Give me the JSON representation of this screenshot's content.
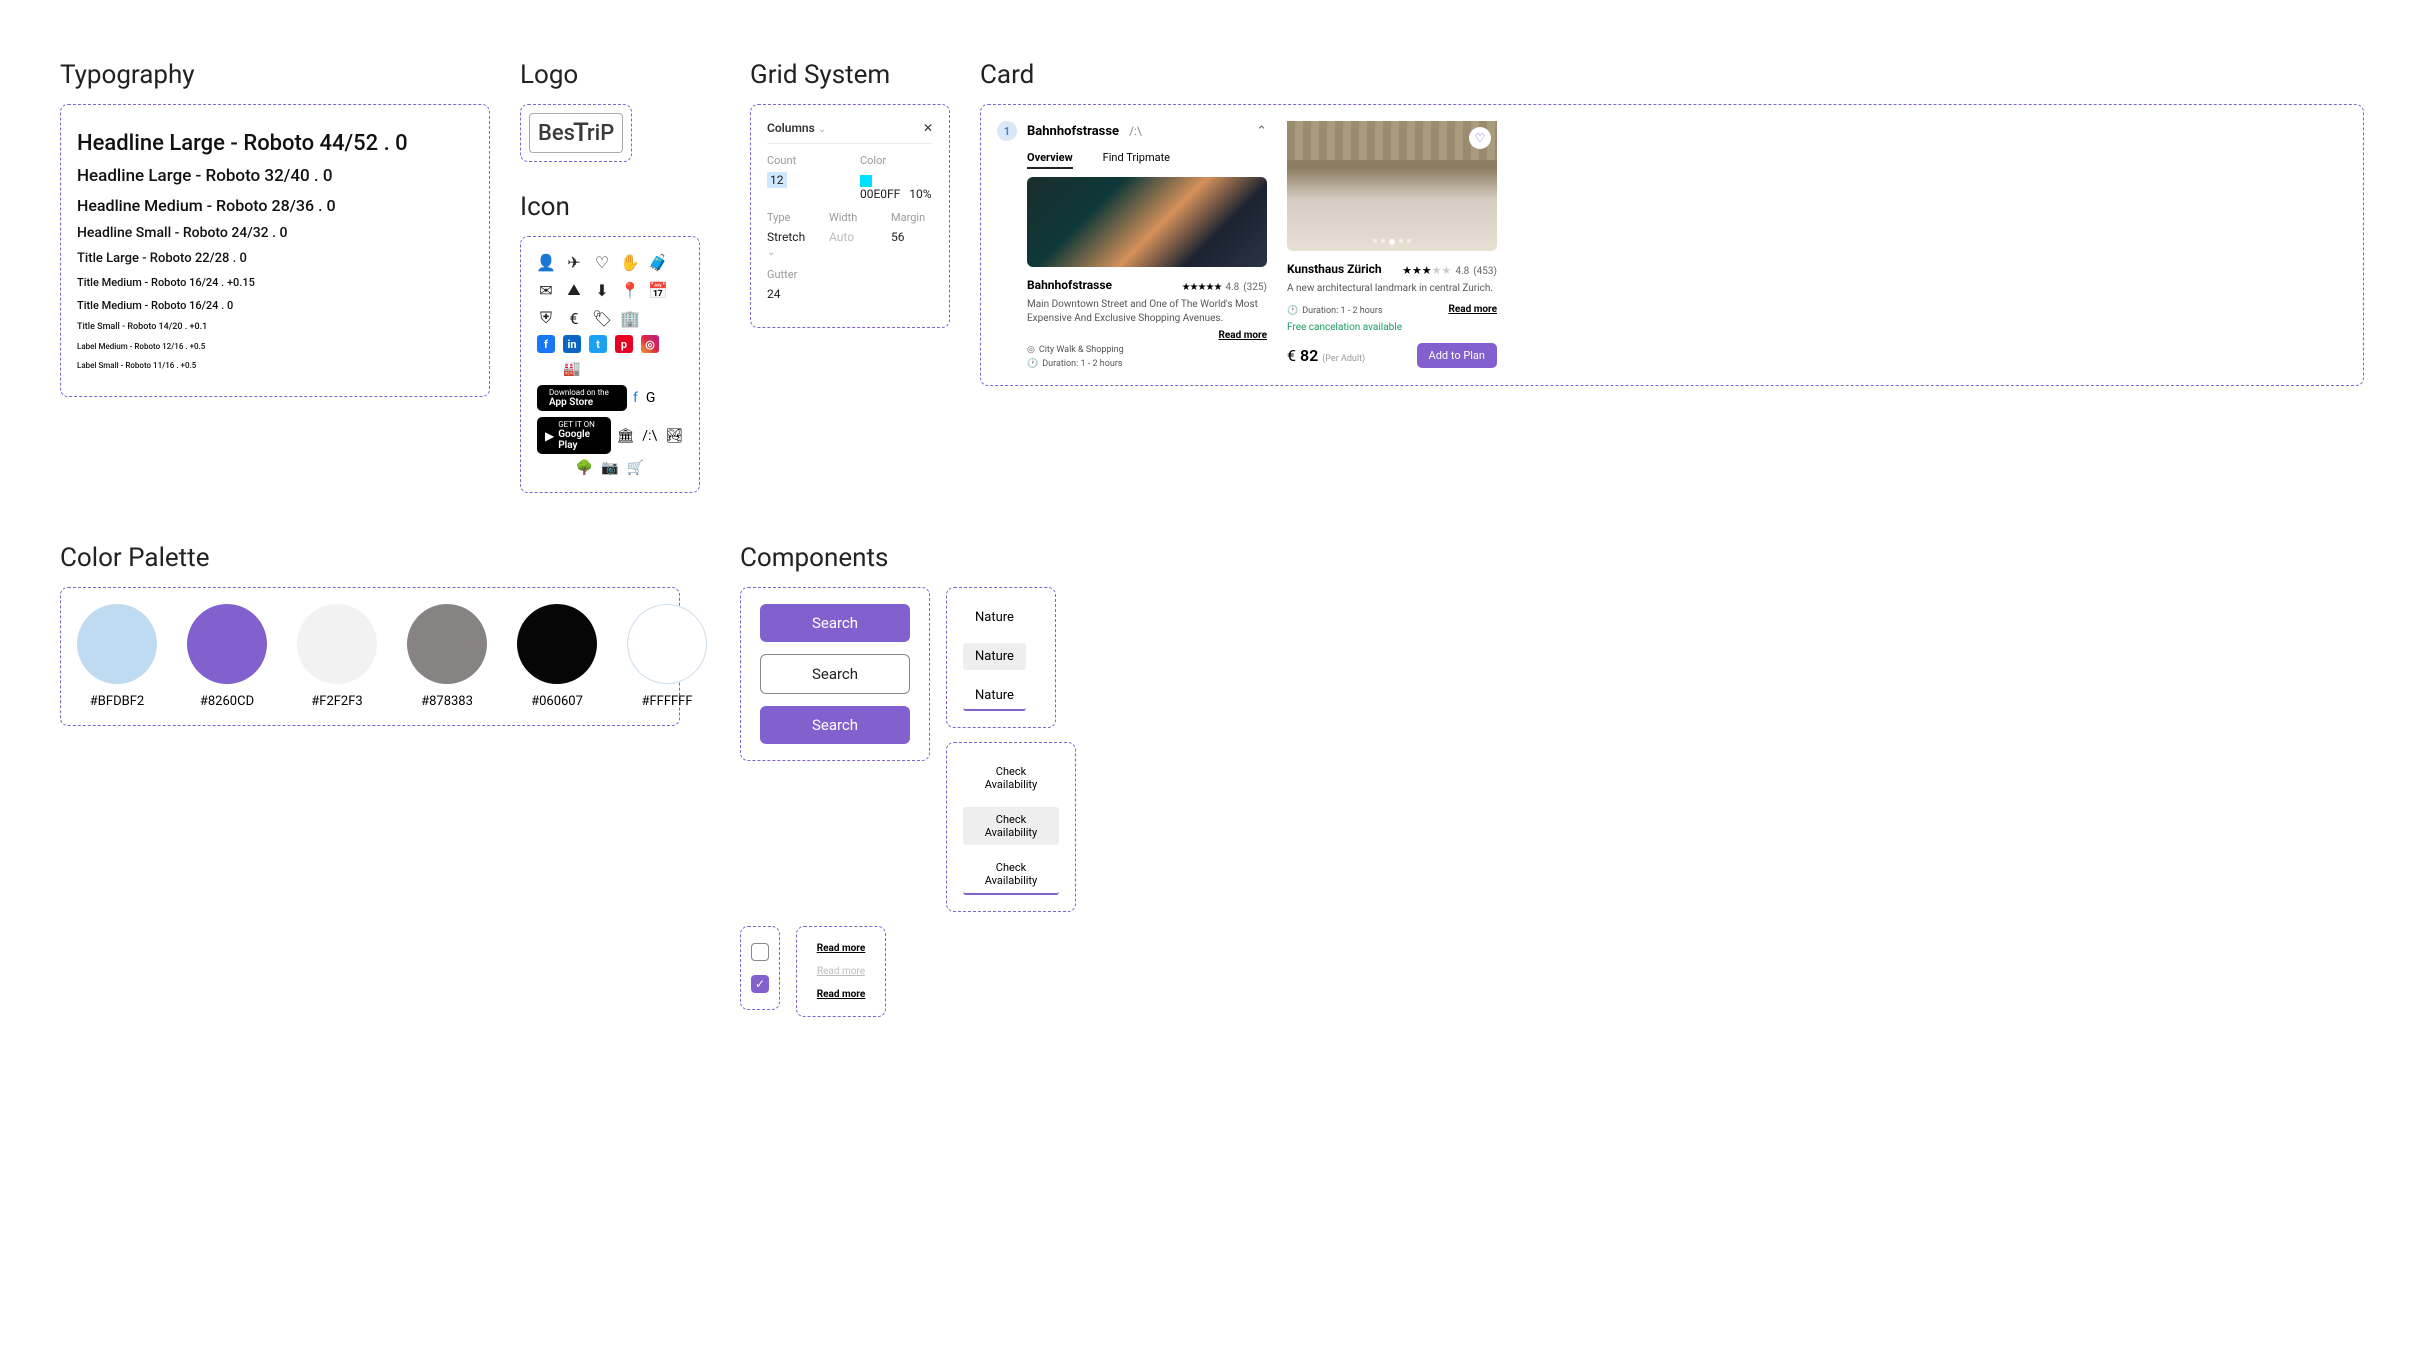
{
  "sections": {
    "typography": "Typography",
    "logo": "Logo",
    "icon": "Icon",
    "grid_system": "Grid System",
    "card": "Card",
    "color_palette": "Color Palette",
    "components": "Components"
  },
  "typography": {
    "lines": [
      "Headline Large - Roboto 44/52 . 0",
      "Headline Large - Roboto 32/40 . 0",
      "Headline Medium - Roboto 28/36 . 0",
      "Headline Small - Roboto 24/32 . 0",
      "Title Large - Roboto 22/28 . 0",
      "Title Medium - Roboto 16/24 . +0.15",
      "Title Medium - Roboto 16/24 . 0",
      "Title Small - Roboto 14/20 . +0.1",
      "Label Medium - Roboto 12/16 . +0.5",
      "Label Small - Roboto 11/16 . +0.5"
    ]
  },
  "logo": {
    "part1": "Bes",
    "part2": "riP"
  },
  "store": {
    "appstore_small": "Download on the",
    "appstore_big": "App Store",
    "gplay_small": "GET IT ON",
    "gplay_big": "Google Play"
  },
  "grid_system": {
    "header": "Columns",
    "count_label": "Count",
    "count_value": "12",
    "color_label": "Color",
    "color_value": "00E0FF",
    "color_alpha": "10%",
    "type_label": "Type",
    "type_value": "Stretch",
    "width_label": "Width",
    "width_value": "Auto",
    "margin_label": "Margin",
    "margin_value": "56",
    "gutter_label": "Gutter",
    "gutter_value": "24"
  },
  "card1": {
    "step": "1",
    "title": "Bahnhofstrasse",
    "symbol": "/:\\",
    "tab_overview": "Overview",
    "tab_tripmate": "Find Tripmate",
    "place": "Bahnhofstrasse",
    "rating": "4.8",
    "rating_count": "(325)",
    "desc": "Main Downtown Street and One of The World's Most Expensive And Exclusive Shopping Avenues.",
    "readmore": "Read more",
    "cat": "City Walk & Shopping",
    "dur": "Duration: 1 - 2 hours"
  },
  "card2": {
    "title": "Kunsthaus Zürich",
    "rating": "4.8",
    "rating_count": "(453)",
    "desc": "A new architectural landmark in central Zurich.",
    "dur": "Duration: 1 - 2 hours",
    "readmore": "Read more",
    "cancel": "Free cancelation available",
    "currency": "€",
    "price": "82",
    "price_sub": "(Per Adult)",
    "btn": "Add to Plan"
  },
  "palette": [
    {
      "hex": "#BFDBF2"
    },
    {
      "hex": "#8260CD"
    },
    {
      "hex": "#F2F2F3"
    },
    {
      "hex": "#878383"
    },
    {
      "hex": "#060607"
    },
    {
      "hex": "#FFFFFF"
    }
  ],
  "components": {
    "search": "Search",
    "nature": "Nature",
    "readmore": "Read more",
    "check_avail": "Check Availability"
  }
}
